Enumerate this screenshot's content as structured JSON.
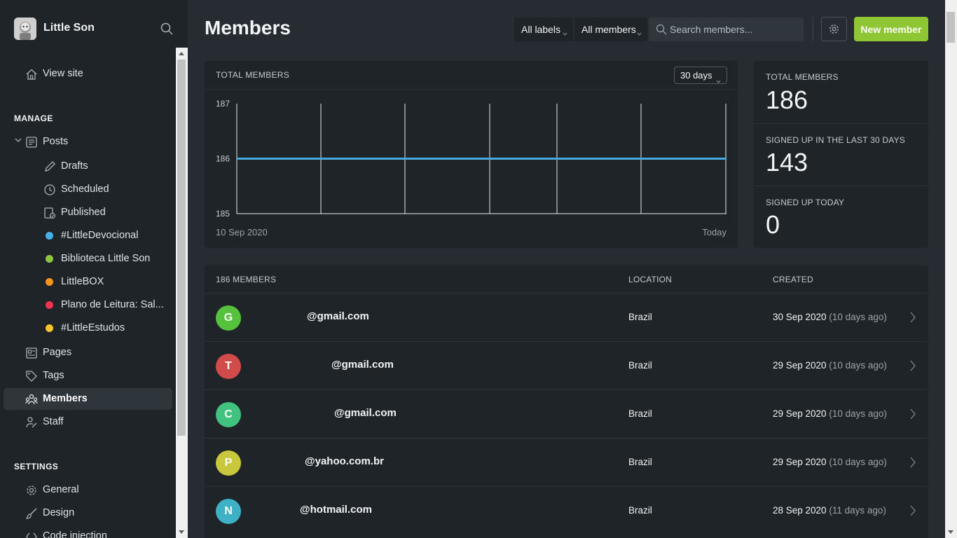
{
  "site": {
    "title": "Little Son"
  },
  "sidebar": {
    "view_site": "View site",
    "manage_title": "MANAGE",
    "posts": "Posts",
    "post_items": [
      {
        "label": "Drafts",
        "icon": "pencil-icon"
      },
      {
        "label": "Scheduled",
        "icon": "clock-icon"
      },
      {
        "label": "Published",
        "icon": "published-icon"
      }
    ],
    "tags": [
      {
        "label": "#LittleDevocional",
        "color": "#45b1e8"
      },
      {
        "label": "Biblioteca Little Son",
        "color": "#8dc63f"
      },
      {
        "label": "LittleBOX",
        "color": "#f7941d"
      },
      {
        "label": "Plano de Leitura: Sal...",
        "color": "#f0344f"
      },
      {
        "label": "#LittleEstudos",
        "color": "#fbc52d"
      }
    ],
    "pages": "Pages",
    "tags_label": "Tags",
    "members": "Members",
    "staff": "Staff",
    "settings_title": "SETTINGS",
    "general": "General",
    "design": "Design",
    "code_injection": "Code injection"
  },
  "header": {
    "title": "Members",
    "labels_filter": "All labels",
    "members_filter": "All members",
    "search_placeholder": "Search members...",
    "new_member": "New member"
  },
  "chart_card": {
    "title": "TOTAL MEMBERS",
    "range": "30 days"
  },
  "chart_data": {
    "type": "line",
    "title": "TOTAL MEMBERS",
    "x_start_label": "10 Sep 2020",
    "x_end_label": "Today",
    "y_ticks": [
      187,
      186,
      185
    ],
    "ylim": [
      185,
      187
    ],
    "series": [
      {
        "values": [
          186,
          186
        ]
      }
    ],
    "color": "#45a9df"
  },
  "stats": {
    "total_label": "TOTAL MEMBERS",
    "total_value": "186",
    "last30_label": "SIGNED UP IN THE LAST 30 DAYS",
    "last30_value": "143",
    "today_label": "SIGNED UP TODAY",
    "today_value": "0"
  },
  "table": {
    "count_header": "186 MEMBERS",
    "location_header": "LOCATION",
    "created_header": "CREATED",
    "rows": [
      {
        "initial": "G",
        "color": "#56c13c",
        "email": "@gmail.com",
        "location": "Brazil",
        "date": "30 Sep 2020",
        "ago": "(10 days ago)"
      },
      {
        "initial": "T",
        "color": "#d24b4b",
        "email": "@gmail.com",
        "location": "Brazil",
        "date": "29 Sep 2020",
        "ago": "(10 days ago)"
      },
      {
        "initial": "C",
        "color": "#3fc37f",
        "email": "@gmail.com",
        "location": "Brazil",
        "date": "29 Sep 2020",
        "ago": "(10 days ago)"
      },
      {
        "initial": "P",
        "color": "#c9c83c",
        "email": "@yahoo.com.br",
        "location": "Brazil",
        "date": "29 Sep 2020",
        "ago": "(10 days ago)"
      },
      {
        "initial": "N",
        "color": "#3fb1c7",
        "email": "@hotmail.com",
        "location": "Brazil",
        "date": "28 Sep 2020",
        "ago": "(11 days ago)"
      }
    ]
  }
}
